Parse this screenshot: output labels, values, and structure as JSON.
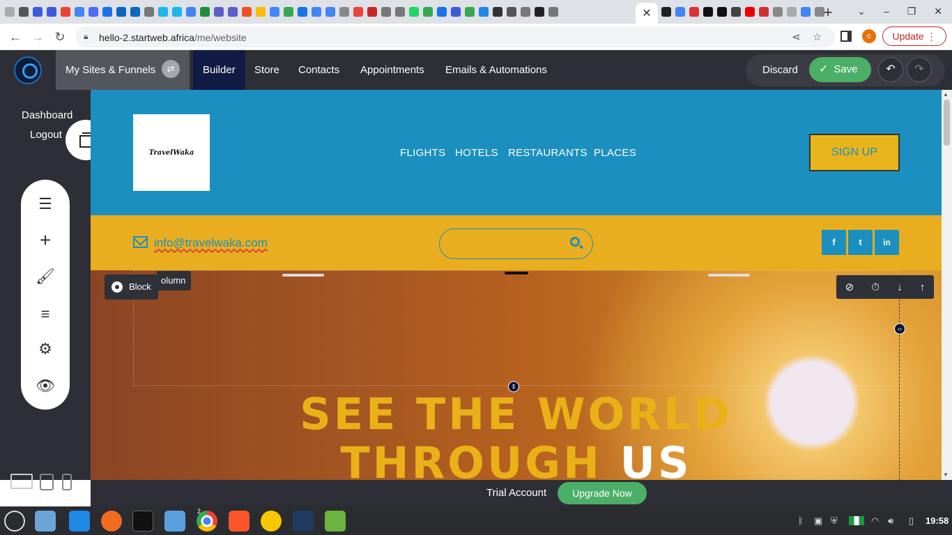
{
  "browser": {
    "url_host": "hello-2.startweb.africa",
    "url_path": "/me/website",
    "profile_initial": "c",
    "update_label": "Update",
    "tab_close": "✕",
    "new_tab": "+"
  },
  "app": {
    "my_sites_label": "My Sites & Funnels",
    "nav": [
      "Builder",
      "Store",
      "Contacts",
      "Appointments",
      "Emails & Automations"
    ],
    "discard_label": "Discard",
    "save_label": "Save"
  },
  "sidebar": {
    "dashboard_label": "Dashboard",
    "logout_label": "Logout",
    "tools": [
      "menu-icon",
      "plus-icon",
      "brush-icon",
      "filter-icon",
      "gear-icon",
      "eye-icon"
    ]
  },
  "site": {
    "logo_text": "TravelWaka",
    "nav": [
      "FLIGHTS",
      "HOTELS",
      "RESTAURANTS",
      "PLACES"
    ],
    "signup_label": "SIGN UP",
    "email": "info@travelwaka.com",
    "social": [
      "f",
      "t",
      "in"
    ],
    "hero_line1": "SEE THE WORLD",
    "hero_line2a": "THROUGH",
    "hero_line2b": "US"
  },
  "editor": {
    "block_label": "Block",
    "column_label": "olumn"
  },
  "trial": {
    "label": "Trial Account",
    "upgrade_label": "Upgrade Now"
  },
  "taskbar": {
    "time": "19:58",
    "badge": "2"
  },
  "colors": {
    "header_blue": "#1b8fc0",
    "bar_yellow": "#e8ae1f",
    "save_green": "#4caf68",
    "app_dark": "#2e2f36"
  }
}
